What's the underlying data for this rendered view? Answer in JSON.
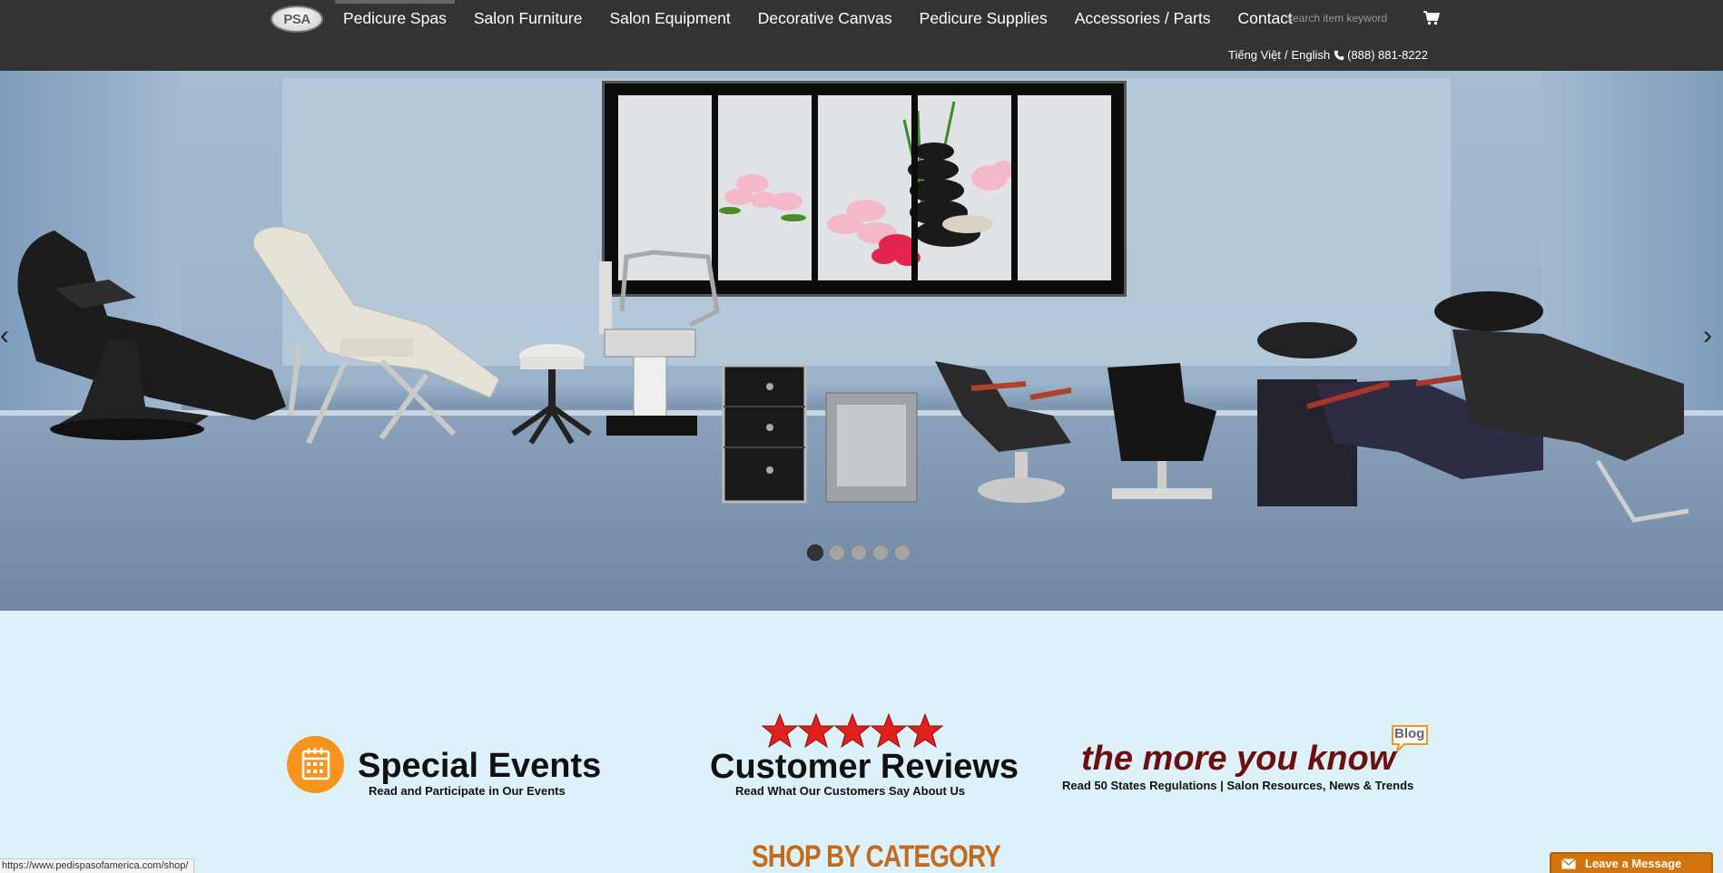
{
  "brand": {
    "logo_text": "PSA"
  },
  "nav": {
    "items": [
      {
        "label": "Pedicure Spas",
        "active": true
      },
      {
        "label": "Salon Furniture",
        "active": false
      },
      {
        "label": "Salon Equipment",
        "active": false
      },
      {
        "label": "Decorative Canvas",
        "active": false
      },
      {
        "label": "Pedicure Supplies",
        "active": false
      },
      {
        "label": "Accessories / Parts",
        "active": false
      },
      {
        "label": "Contact",
        "active": false
      }
    ],
    "search_placeholder": "search item keyword",
    "cart_icon": "shopping-cart-icon"
  },
  "utility": {
    "language_vi": "Tiếng Việt",
    "language_sep": "/",
    "language_en": "English",
    "phone": "(888) 881-8222"
  },
  "slider": {
    "prev_glyph": "‹",
    "next_glyph": "›",
    "slide_count": 5,
    "active_slide": 1
  },
  "promos": {
    "events": {
      "title": "Special Events",
      "subtitle": "Read and Participate in Our Events"
    },
    "reviews": {
      "title": "Customer Reviews",
      "subtitle": "Read What Our Customers Say About Us",
      "stars": 5
    },
    "blog": {
      "badge": "Blog",
      "title": "the more you know",
      "subtitle": "Read 50 States Regulations | Salon Resources, News & Trends"
    }
  },
  "shop_heading": "SHOP BY CATEGORY",
  "status_bar_url": "https://www.pedispasofamerica.com/shop/",
  "chat": {
    "label": "Leave a Message"
  },
  "colors": {
    "topbar": "#333333",
    "page_bg": "#dcf1fa",
    "accent_orange": "#f7941d",
    "heading_orange": "#c36a1c",
    "blog_maroon": "#6b0f0f",
    "star_red": "#e0201b",
    "chat_orange": "#d4740d"
  }
}
